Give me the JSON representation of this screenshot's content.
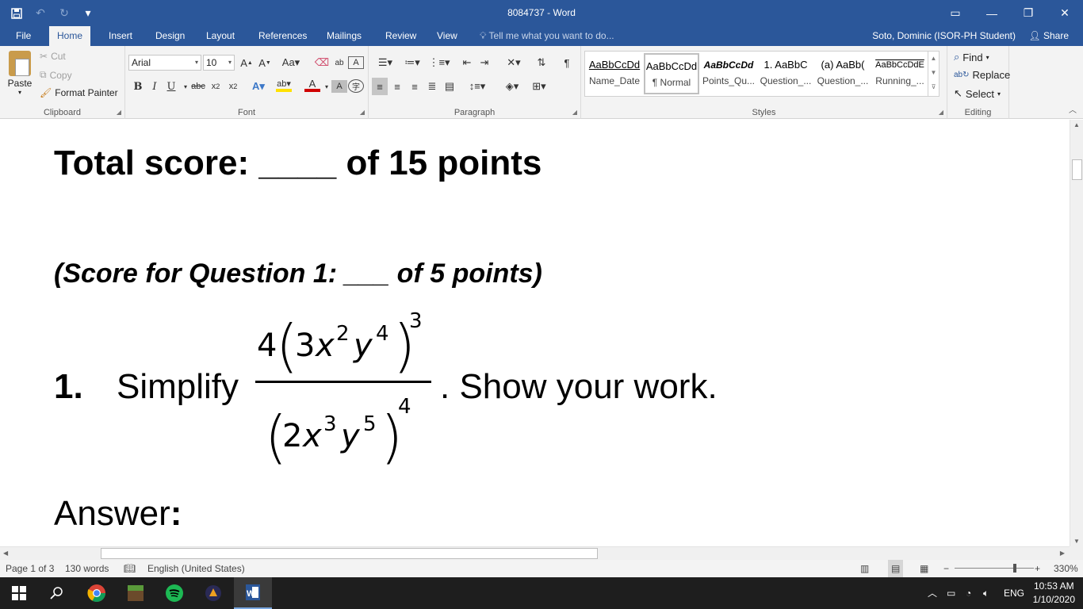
{
  "window": {
    "title": "8084737 - Word",
    "controls": {
      "ribbon_display": "▭",
      "minimize": "—",
      "restore": "❐",
      "close": "✕"
    }
  },
  "quick_access": {
    "save_icon": "save-icon",
    "undo_icon": "undo-icon",
    "redo_icon": "redo-icon",
    "customize_icon": "customize-icon"
  },
  "menu": {
    "tabs": [
      "File",
      "Home",
      "Insert",
      "Design",
      "Layout",
      "References",
      "Mailings",
      "Review",
      "View"
    ],
    "active_tab": "Home",
    "tell_me": "Tell me what you want to do...",
    "user": "Soto, Dominic (ISOR-PH Student)",
    "share": "Share"
  },
  "ribbon": {
    "clipboard": {
      "label": "Clipboard",
      "paste": "Paste",
      "cut": "Cut",
      "copy": "Copy",
      "format_painter": "Format Painter"
    },
    "font": {
      "label": "Font",
      "family": "Arial",
      "size": "10"
    },
    "paragraph": {
      "label": "Paragraph"
    },
    "styles": {
      "label": "Styles",
      "items": [
        {
          "preview": "AaBbCcDd",
          "name": "Name_Date"
        },
        {
          "preview": "AaBbCcDd",
          "name": "¶ Normal"
        },
        {
          "preview": "AaBbCcDd",
          "name": "Points_Qu..."
        },
        {
          "preview": "1. AaBbC",
          "name": "Question_..."
        },
        {
          "preview": "(a) AaBb(",
          "name": "Question_..."
        },
        {
          "preview": "AaBbCcDdE",
          "name": "Running_..."
        }
      ]
    },
    "editing": {
      "label": "Editing",
      "find": "Find",
      "replace": "Replace",
      "select": "Select"
    }
  },
  "document": {
    "total_score": "Total score: ____ of 15 points",
    "question_score": "(Score for Question 1: ___ of 5 points)",
    "question_number": "1.",
    "question_lead": "Simplify",
    "question_tail": ". Show your work.",
    "numerator": {
      "coef": "4",
      "inner_coef": "3",
      "var1": "x",
      "exp1": "2",
      "var2": "y",
      "exp2": "4",
      "outer_exp": "3"
    },
    "denominator": {
      "inner_coef": "2",
      "var1": "x",
      "exp1": "3",
      "var2": "y",
      "exp2": "5",
      "outer_exp": "4"
    },
    "answer_label": "Answer",
    "answer_colon": ":"
  },
  "statusbar": {
    "page": "Page 1 of 3",
    "words": "130 words",
    "language": "English (United States)",
    "zoom": "330%"
  },
  "taskbar": {
    "apps": [
      "start-icon",
      "search-icon",
      "chrome-icon",
      "minecraft-icon",
      "spotify-icon",
      "game-icon",
      "word-icon"
    ],
    "language": "ENG",
    "time": "10:53 AM",
    "date": "1/10/2020"
  }
}
